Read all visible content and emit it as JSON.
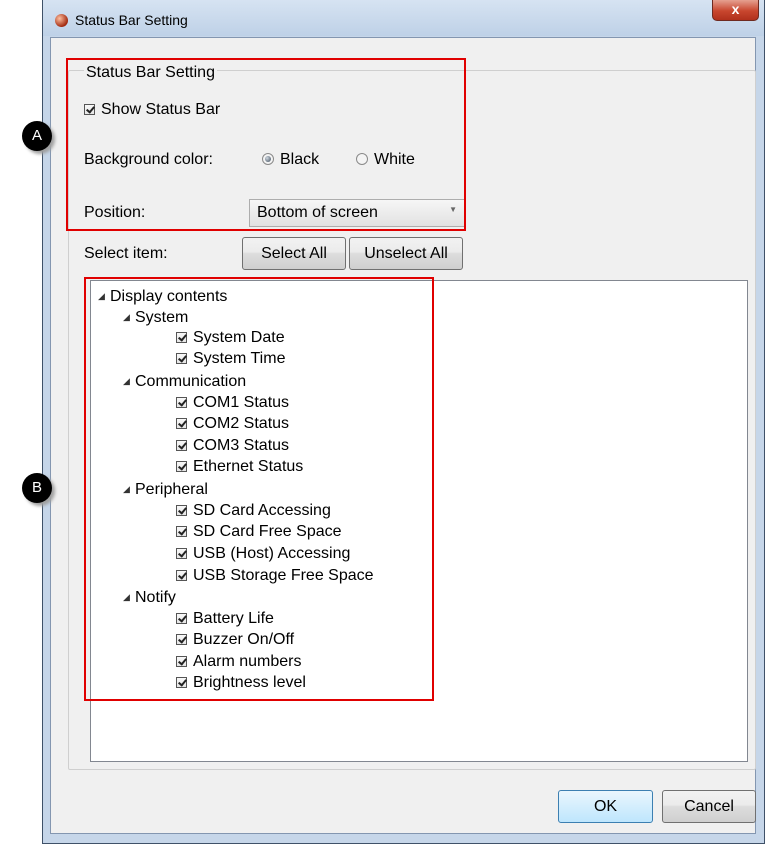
{
  "window": {
    "title": "Status Bar Setting",
    "close_label": "x"
  },
  "group": {
    "title": "Status Bar Setting",
    "show_status_bar": {
      "label": "Show Status Bar",
      "checked": true
    },
    "background": {
      "label": "Background color:",
      "options": [
        "Black",
        "White"
      ],
      "selected": "Black"
    },
    "position": {
      "label": "Position:",
      "value": "Bottom of screen"
    }
  },
  "select": {
    "label": "Select item:",
    "select_all": "Select All",
    "unselect_all": "Unselect All"
  },
  "tree": {
    "root": "Display contents",
    "groups": [
      {
        "name": "System",
        "items": [
          "System Date",
          "System Time"
        ]
      },
      {
        "name": "Communication",
        "items": [
          "COM1 Status",
          "COM2 Status",
          "COM3 Status",
          "Ethernet Status"
        ]
      },
      {
        "name": "Peripheral",
        "items": [
          "SD Card Accessing",
          "SD Card Free Space",
          "USB (Host) Accessing",
          "USB Storage Free Space"
        ]
      },
      {
        "name": "Notify",
        "items": [
          "Battery Life",
          "Buzzer On/Off",
          "Alarm numbers",
          "Brightness level"
        ]
      }
    ]
  },
  "footer": {
    "ok": "OK",
    "cancel": "Cancel"
  },
  "callouts": {
    "a": "A",
    "b": "B"
  },
  "colors": {
    "highlight_box": "#e00000",
    "title_bar": "#c6d6e9",
    "close_button": "#c8462e"
  }
}
